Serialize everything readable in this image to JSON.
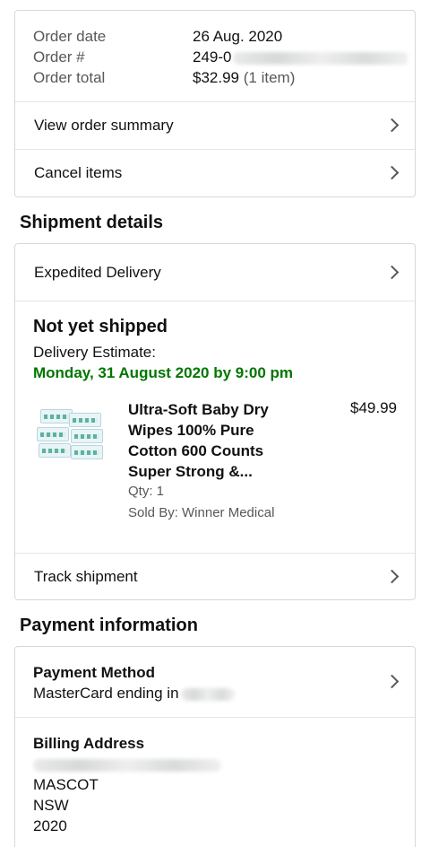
{
  "order": {
    "date_label": "Order date",
    "date_value": "26 Aug. 2020",
    "number_label": "Order #",
    "number_value": "249-0",
    "total_label": "Order total",
    "total_value": "$32.99",
    "total_items": "(1 item)",
    "view_summary": "View order summary",
    "cancel_items": "Cancel items"
  },
  "shipment": {
    "section_title": "Shipment details",
    "delivery_type": "Expedited Delivery",
    "status": "Not yet shipped",
    "estimate_label": "Delivery Estimate:",
    "estimate_value": "Monday, 31 August 2020 by 9:00 pm",
    "product": {
      "name": "Ultra-Soft Baby Dry Wipes 100% Pure Cotton 600 Counts Super Strong &...",
      "price": "$49.99",
      "qty": "Qty: 1",
      "sold_by": "Sold By: Winner Medical"
    },
    "track": "Track shipment"
  },
  "payment": {
    "section_title": "Payment information",
    "method_label": "Payment Method",
    "method_value": "MasterCard ending in",
    "billing_label": "Billing Address",
    "billing_lines": [
      "MASCOT",
      "NSW",
      "2020"
    ]
  },
  "colors": {
    "accent_green": "#007600",
    "border": "#d5d9d9",
    "muted_text": "#565959"
  }
}
